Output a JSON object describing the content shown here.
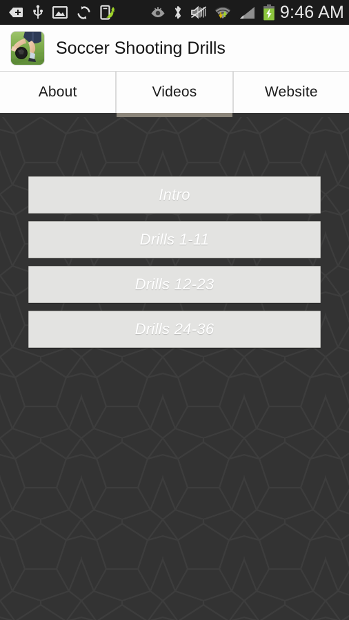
{
  "statusbar": {
    "time": "9:46 AM",
    "background": "#1b1b1b",
    "text_color": "#e8e8e8",
    "left_icons": [
      {
        "name": "back-arrow-icon",
        "label": "back"
      },
      {
        "name": "usb-icon",
        "label": "USB connected"
      },
      {
        "name": "image-icon",
        "label": "screenshot captured"
      },
      {
        "name": "sync-icon",
        "label": "syncing"
      },
      {
        "name": "phone-transfer-icon",
        "label": "smart switch"
      }
    ],
    "right_icons": [
      {
        "name": "eye-icon",
        "label": "smart stay"
      },
      {
        "name": "bluetooth-icon",
        "label": "bluetooth on"
      },
      {
        "name": "mute-vibrate-icon",
        "label": "sound off / vibrate"
      },
      {
        "name": "wifi-icon",
        "label": "wifi connected"
      },
      {
        "name": "cellular-signal-icon",
        "label": "mobile signal"
      },
      {
        "name": "battery-charging-icon",
        "label": "battery charging"
      }
    ],
    "battery_color": "#8cc63e"
  },
  "appbar": {
    "title": "Soccer Shooting Drills",
    "icon_name": "app-icon-soccer-player",
    "background": "#fdfdfd",
    "title_color": "#141414"
  },
  "tabs": {
    "selected_index": 1,
    "indicator_color": "#8b857a",
    "items": [
      {
        "label": "About",
        "name": "tab-about"
      },
      {
        "label": "Videos",
        "name": "tab-videos"
      },
      {
        "label": "Website",
        "name": "tab-website"
      }
    ]
  },
  "content": {
    "background": "#333333",
    "pattern": "pentagon-tessellation",
    "buttons": [
      {
        "label": "Intro",
        "name": "video-button-intro"
      },
      {
        "label": "Drills 1-11",
        "name": "video-button-drills-1-11"
      },
      {
        "label": "Drills 12-23",
        "name": "video-button-drills-12-23"
      },
      {
        "label": "Drills 24-36",
        "name": "video-button-drills-24-36"
      }
    ],
    "button_background": "#e3e3e1",
    "button_text_color": "#ffffff"
  }
}
